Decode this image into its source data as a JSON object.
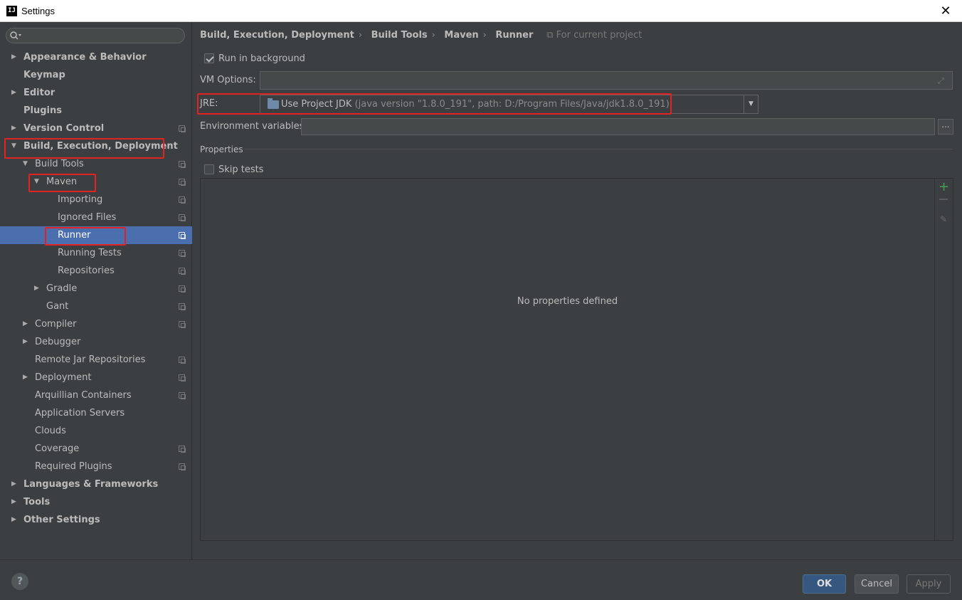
{
  "window": {
    "title": "Settings",
    "app_icon": "IJ"
  },
  "search": {
    "placeholder": ""
  },
  "tree": [
    {
      "label": "Appearance & Behavior",
      "level": 0,
      "arrow": "▶",
      "bold": true,
      "project": false
    },
    {
      "label": "Keymap",
      "level": 0,
      "arrow": "",
      "bold": true,
      "project": false
    },
    {
      "label": "Editor",
      "level": 0,
      "arrow": "▶",
      "bold": true,
      "project": false
    },
    {
      "label": "Plugins",
      "level": 0,
      "arrow": "",
      "bold": true,
      "project": false
    },
    {
      "label": "Version Control",
      "level": 0,
      "arrow": "▶",
      "bold": true,
      "project": true
    },
    {
      "label": "Build, Execution, Deployment",
      "level": 0,
      "arrow": "▼",
      "bold": true,
      "project": false
    },
    {
      "label": "Build Tools",
      "level": 1,
      "arrow": "▼",
      "bold": false,
      "project": true
    },
    {
      "label": "Maven",
      "level": 2,
      "arrow": "▼",
      "bold": false,
      "project": true
    },
    {
      "label": "Importing",
      "level": 3,
      "arrow": "",
      "bold": false,
      "project": true
    },
    {
      "label": "Ignored Files",
      "level": 3,
      "arrow": "",
      "bold": false,
      "project": true
    },
    {
      "label": "Runner",
      "level": 3,
      "arrow": "",
      "bold": false,
      "project": true,
      "selected": true
    },
    {
      "label": "Running Tests",
      "level": 3,
      "arrow": "",
      "bold": false,
      "project": true
    },
    {
      "label": "Repositories",
      "level": 3,
      "arrow": "",
      "bold": false,
      "project": true
    },
    {
      "label": "Gradle",
      "level": 2,
      "arrow": "▶",
      "bold": false,
      "project": true
    },
    {
      "label": "Gant",
      "level": 2,
      "arrow": "",
      "bold": false,
      "project": true
    },
    {
      "label": "Compiler",
      "level": 1,
      "arrow": "▶",
      "bold": false,
      "project": true
    },
    {
      "label": "Debugger",
      "level": 1,
      "arrow": "▶",
      "bold": false,
      "project": false
    },
    {
      "label": "Remote Jar Repositories",
      "level": 1,
      "arrow": "",
      "bold": false,
      "project": true
    },
    {
      "label": "Deployment",
      "level": 1,
      "arrow": "▶",
      "bold": false,
      "project": true
    },
    {
      "label": "Arquillian Containers",
      "level": 1,
      "arrow": "",
      "bold": false,
      "project": true
    },
    {
      "label": "Application Servers",
      "level": 1,
      "arrow": "",
      "bold": false,
      "project": false
    },
    {
      "label": "Clouds",
      "level": 1,
      "arrow": "",
      "bold": false,
      "project": false
    },
    {
      "label": "Coverage",
      "level": 1,
      "arrow": "",
      "bold": false,
      "project": true
    },
    {
      "label": "Required Plugins",
      "level": 1,
      "arrow": "",
      "bold": false,
      "project": true
    },
    {
      "label": "Languages & Frameworks",
      "level": 0,
      "arrow": "▶",
      "bold": true,
      "project": false
    },
    {
      "label": "Tools",
      "level": 0,
      "arrow": "▶",
      "bold": true,
      "project": false
    },
    {
      "label": "Other Settings",
      "level": 0,
      "arrow": "▶",
      "bold": true,
      "project": false
    }
  ],
  "breadcrumb": {
    "items": [
      "Build, Execution, Deployment",
      "Build Tools",
      "Maven",
      "Runner"
    ],
    "separator": "›",
    "scope": "For current project"
  },
  "runner": {
    "run_in_background_label": "Run in background",
    "run_in_background_checked": true,
    "vm_options_label": "VM Options:",
    "vm_options_value": "",
    "jre_label": "JRE:",
    "jre_main": "Use Project JDK",
    "jre_detail": "(java version \"1.8.0_191\", path: D:/Program Files/Java/jdk1.8.0_191)",
    "env_label": "Environment variables:",
    "env_value": "",
    "env_button": "...",
    "properties_label": "Properties",
    "skip_tests_label": "Skip tests",
    "skip_tests_checked": false,
    "empty_properties": "No properties defined"
  },
  "buttons": {
    "ok": "OK",
    "cancel": "Cancel",
    "apply": "Apply",
    "help": "?"
  },
  "colors": {
    "highlight": "#e32222",
    "selection": "#4b6eaf",
    "background": "#3c3f41"
  }
}
